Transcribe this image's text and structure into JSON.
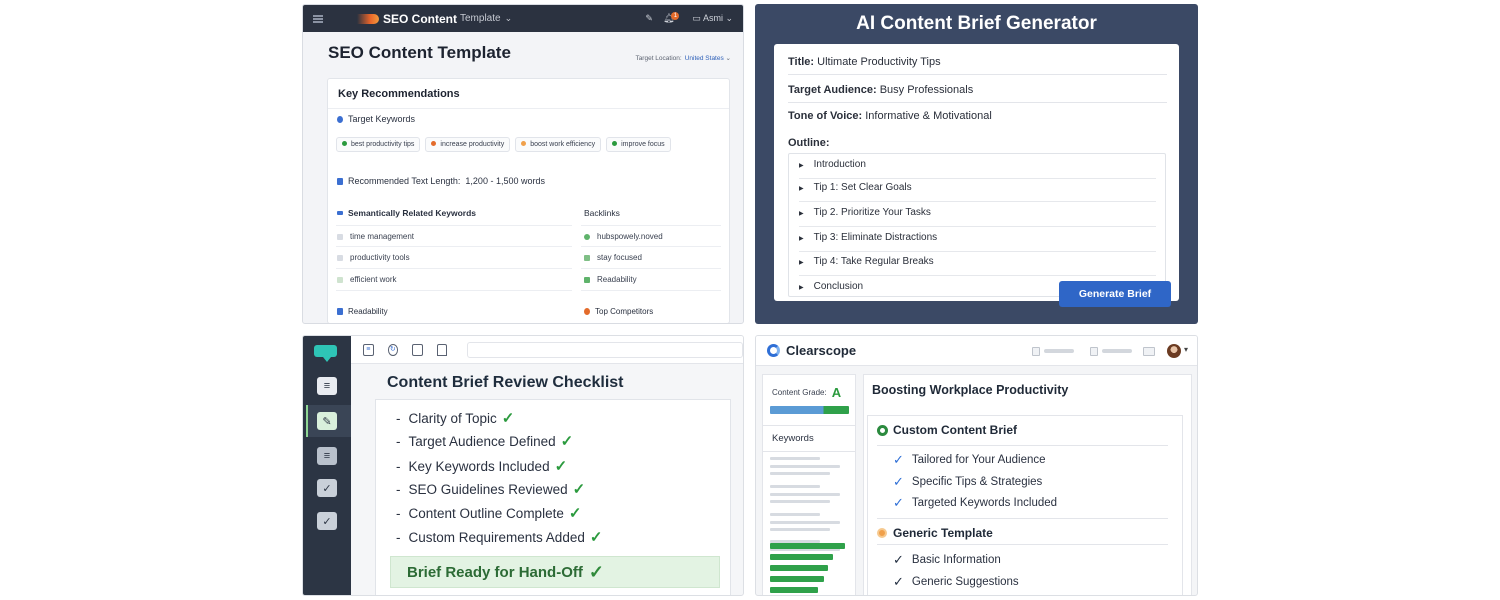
{
  "seo_template": {
    "brand": "SEO Content",
    "brand_sub": "Template",
    "user": "Asmi",
    "notif_count": "1",
    "title": "SEO Content Template",
    "location_label": "Target Location:",
    "location_value": "United States",
    "card_title": "Key Recommendations",
    "target_keywords_label": "Target Keywords",
    "keywords": [
      {
        "label": "best productivity tips",
        "color": "#2b9a3e"
      },
      {
        "label": "increase productivity",
        "color": "#e36b2b"
      },
      {
        "label": "boost work efficiency",
        "color": "#f0a04b"
      },
      {
        "label": "improve focus",
        "color": "#2b9a3e"
      }
    ],
    "text_length_label": "Recommended Text Length:",
    "text_length_value": "1,200 - 1,500 words",
    "semantic_label": "Semantically Related Keywords",
    "semantic_items": [
      "time management",
      "productivity tools",
      "efficient work"
    ],
    "backlinks_label": "Backlinks",
    "backlink_items": [
      "hubspowely.noved",
      "stay focused",
      "Readability"
    ],
    "readability_label": "Readability",
    "competitors_label": "Top Competitors"
  },
  "brief_generator": {
    "title": "AI Content Brief Generator",
    "fields": [
      {
        "label": "Title:",
        "value": "Ultimate Productivity Tips"
      },
      {
        "label": "Target Audience:",
        "value": "Busy Professionals"
      },
      {
        "label": "Tone of Voice:",
        "value": "Informative & Motivational"
      }
    ],
    "outline_label": "Outline:",
    "outline": [
      "Introduction",
      "Tip 1: Set Clear Goals",
      "Tip 2. Prioritize Your Tasks",
      "Tip 3: Eliminate Distractions",
      "Tip 4: Take Regular Breaks",
      "Conclusion"
    ],
    "generate_button": "Generate Brief"
  },
  "checklist": {
    "title": "Content Brief Review Checklist",
    "items": [
      "Clarity of Topic",
      "Target Audience Defined",
      "Key Keywords Included",
      "SEO Guidelines Reviewed",
      "Content Outline Complete",
      "Custom Requirements Added"
    ],
    "ready_label": "Brief Ready for Hand-Off",
    "check_color": "#2b9a3e"
  },
  "clearscope": {
    "brand": "Clearscope",
    "grade_label": "Content Grade:",
    "grade_value": "A",
    "keywords_label": "Keywords",
    "doc_title": "Boosting Workplace Productivity",
    "custom_heading": "Custom Content Brief",
    "custom_items": [
      "Tailored for Your Audience",
      "Specific Tips & Strategies",
      "Targeted Keywords Included"
    ],
    "generic_heading": "Generic Template",
    "generic_items": [
      "Basic Information",
      "Generic Suggestions"
    ]
  }
}
